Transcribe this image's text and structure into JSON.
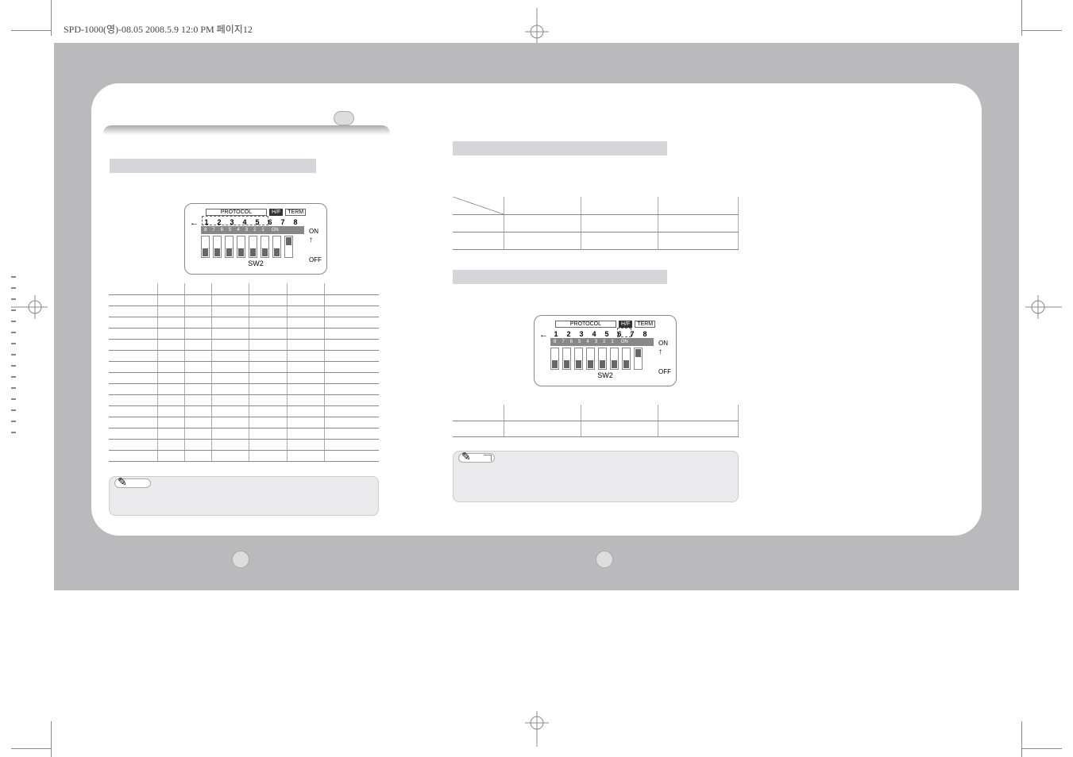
{
  "meta": {
    "header_text": "SPD-1000(영)-08.05  2008.5.9 12:0 PM  페이지12"
  },
  "dip": {
    "labels": {
      "protocol": "PROTOCOL",
      "hrif": "H/F",
      "term": "TERM"
    },
    "numbers": [
      "1",
      "2",
      "3",
      "4",
      "5",
      "6",
      "7",
      "8"
    ],
    "strip_rev": [
      "8",
      "7",
      "6",
      "5",
      "4",
      "3",
      "2",
      "1"
    ],
    "on": "ON",
    "off": "OFF",
    "on_small": "ON",
    "sw": "SW2",
    "arrow": "←"
  },
  "left_page": {
    "protocol_table": {
      "rows": 16,
      "cols": 7
    },
    "note_label": ""
  },
  "right_page": {
    "table1": {
      "rows": 3,
      "cols": 4
    },
    "table2": {
      "rows": 2,
      "cols": 4
    },
    "note_label": ""
  },
  "page_numbers": {
    "left": "",
    "right": ""
  }
}
